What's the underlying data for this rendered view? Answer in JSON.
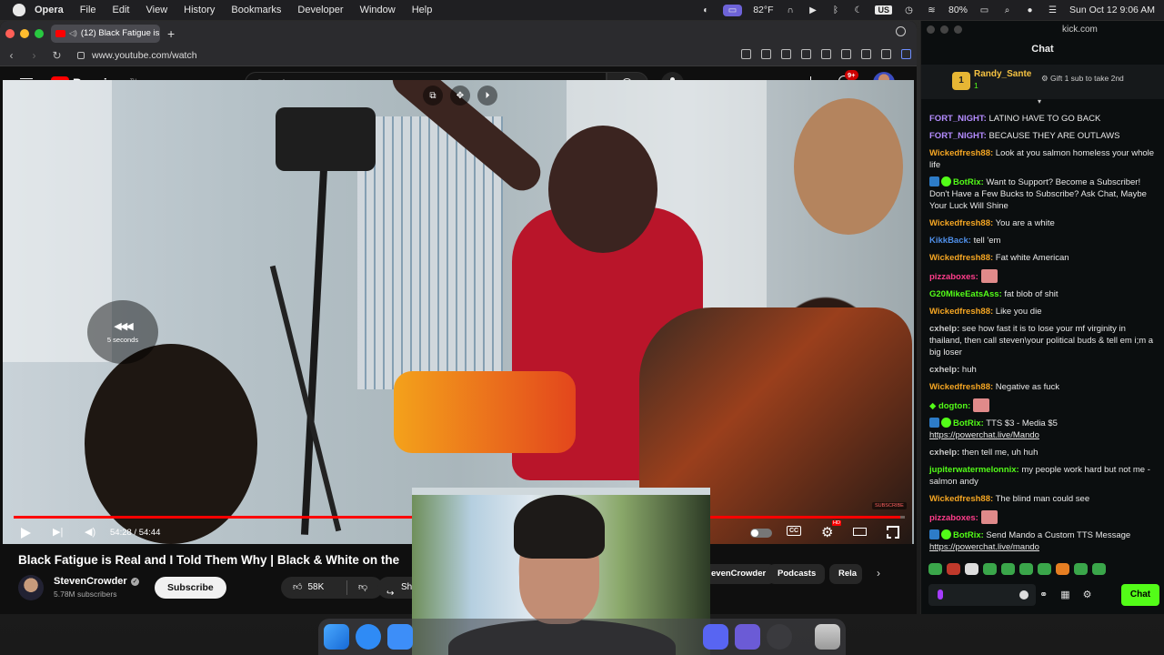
{
  "menubar": {
    "app": "Opera",
    "items": [
      "File",
      "Edit",
      "View",
      "History",
      "Bookmarks",
      "Developer",
      "Window",
      "Help"
    ],
    "weather": "82°F",
    "battery": "80%",
    "lang": "US",
    "datetime": "Sun Oct 12  9:06 AM"
  },
  "browser": {
    "tab_title": "(12) Black Fatigue is",
    "url": "www.youtube.com/watch"
  },
  "youtube": {
    "logo": "Premium",
    "logo_sup": "TH",
    "search_placeholder": "Search",
    "notif_count": "9+",
    "video": {
      "seek_text": "5 seconds",
      "current_time": "54:28",
      "duration": "54:44",
      "time_display": "54:28 / 54:44",
      "progress": 0.995,
      "subscribe_watermark": "SUBSCRIBE"
    },
    "title": "Black Fatigue is Real and I Told Them Why | Black & White on the",
    "channel": {
      "name": "StevenCrowder",
      "subscribers": "5.78M subscribers",
      "subscribe_label": "Subscribe",
      "likes": "58K",
      "share_label": "Share"
    },
    "chips": [
      "evenCrowder",
      "Podcasts",
      "Rela"
    ]
  },
  "kick": {
    "url": "kick.com",
    "title": "Chat",
    "pinned": {
      "rank": "1",
      "user": "Randy_Sante",
      "count": "1",
      "gift_text": "Gift 1 sub to take 2nd"
    },
    "messages": [
      {
        "user": "FORT_NIGHT:",
        "color": "#b48cff",
        "text": "LATINO HAVE TO GO BACK"
      },
      {
        "user": "FORT_NIGHT:",
        "color": "#b48cff",
        "text": "BECAUSE THEY ARE OUTLAWS"
      },
      {
        "user": "Wickedfresh88:",
        "color": "#f5a623",
        "text": "Look at you salmon homeless your whole life"
      },
      {
        "user": "BotRix:",
        "color": "#53fc18",
        "text": "Want to Support? Become a Subscriber! Don't Have a Few Bucks to Subscribe? Ask Chat, Maybe Your Luck Will Shine",
        "bot": true
      },
      {
        "user": "Wickedfresh88:",
        "color": "#f5a623",
        "text": "You are a white"
      },
      {
        "user": "KikkBack:",
        "color": "#4f8fe8",
        "text": "tell 'em"
      },
      {
        "user": "Wickedfresh88:",
        "color": "#f5a623",
        "text": "Fat white American"
      },
      {
        "user": "pizzaboxes:",
        "color": "#ff3d8b",
        "text": "",
        "emote": true
      },
      {
        "user": "G20MikeEatsAss:",
        "color": "#53fc18",
        "text": "fat blob of shit"
      },
      {
        "user": "Wickedfresh88:",
        "color": "#f5a623",
        "text": "Like you die"
      },
      {
        "user": "cxhelp:",
        "color": "#c8c8c8",
        "text": "see how fast it is to lose your mf virginity in thailand, then call steven\\your political buds & tell em i;m a big loser"
      },
      {
        "user": "cxhelp:",
        "color": "#c8c8c8",
        "text": "huh"
      },
      {
        "user": "Wickedfresh88:",
        "color": "#f5a623",
        "text": "Negative as fuck"
      },
      {
        "user": "dogton:",
        "color": "#53fc18",
        "text": "",
        "emote": true,
        "diamond": true
      },
      {
        "user": "BotRix:",
        "color": "#53fc18",
        "text": "TTS $3 - Media $5",
        "bot": true,
        "link": "https://powerchat.live/Mando"
      },
      {
        "user": "cxhelp:",
        "color": "#c8c8c8",
        "text": "then tell me, uh huh"
      },
      {
        "user": "jupiterwatermelonnix:",
        "color": "#53fc18",
        "text": "my people work hard but not me - salmon andy"
      },
      {
        "user": "Wickedfresh88:",
        "color": "#f5a623",
        "text": "The blind man could see"
      },
      {
        "user": "pizzaboxes:",
        "color": "#ff3d8b",
        "text": "",
        "emote": true
      },
      {
        "user": "BotRix:",
        "color": "#53fc18",
        "text": "Send Mando a Custom TTS Message",
        "bot": true,
        "link": "https://powerchat.live/mando"
      }
    ],
    "chat_button": "Chat"
  },
  "colors": {
    "kick_green": "#53fc18",
    "youtube_red": "#ff0000"
  }
}
